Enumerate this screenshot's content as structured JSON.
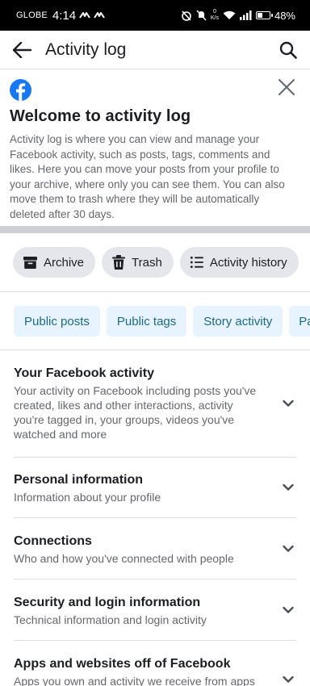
{
  "status_bar": {
    "carrier": "GLOBE",
    "time": "4:14",
    "net_speed_top": "0",
    "net_speed_bottom": "K/s",
    "battery": "48%",
    "battery_level": 0.48
  },
  "header": {
    "title": "Activity log"
  },
  "welcome": {
    "title": "Welcome to activity log",
    "body": "Activity log is where you can view and manage your Facebook activity, such as posts, tags, comments and likes. Here you can move your posts from your profile to your archive, where only you can see them. You can also move them to trash where they will be automatically deleted after 30 days."
  },
  "actions": [
    {
      "label": "Archive",
      "icon": "archive-icon"
    },
    {
      "label": "Trash",
      "icon": "trash-icon"
    },
    {
      "label": "Activity history",
      "icon": "list-icon"
    }
  ],
  "filters": [
    "Public posts",
    "Public tags",
    "Story activity",
    "Pa"
  ],
  "sections": [
    {
      "title": "Your Facebook activity",
      "desc": "Your activity on Facebook including posts you've created, likes and other interactions, activity you're tagged in, your groups, videos you've watched and more"
    },
    {
      "title": "Personal information",
      "desc": "Information about your profile"
    },
    {
      "title": "Connections",
      "desc": "Who and how you've connected with people"
    },
    {
      "title": "Security and login information",
      "desc": "Technical information and login activity"
    },
    {
      "title": "Apps and websites off of Facebook",
      "desc": "Apps you own and activity we receive from apps"
    }
  ],
  "colors": {
    "facebook_blue": "#1877f2",
    "chip_background": "#e7f3ff",
    "chip_text": "#1d6a82",
    "pill_background": "#e4e6eb",
    "secondary_text": "#65676b"
  }
}
